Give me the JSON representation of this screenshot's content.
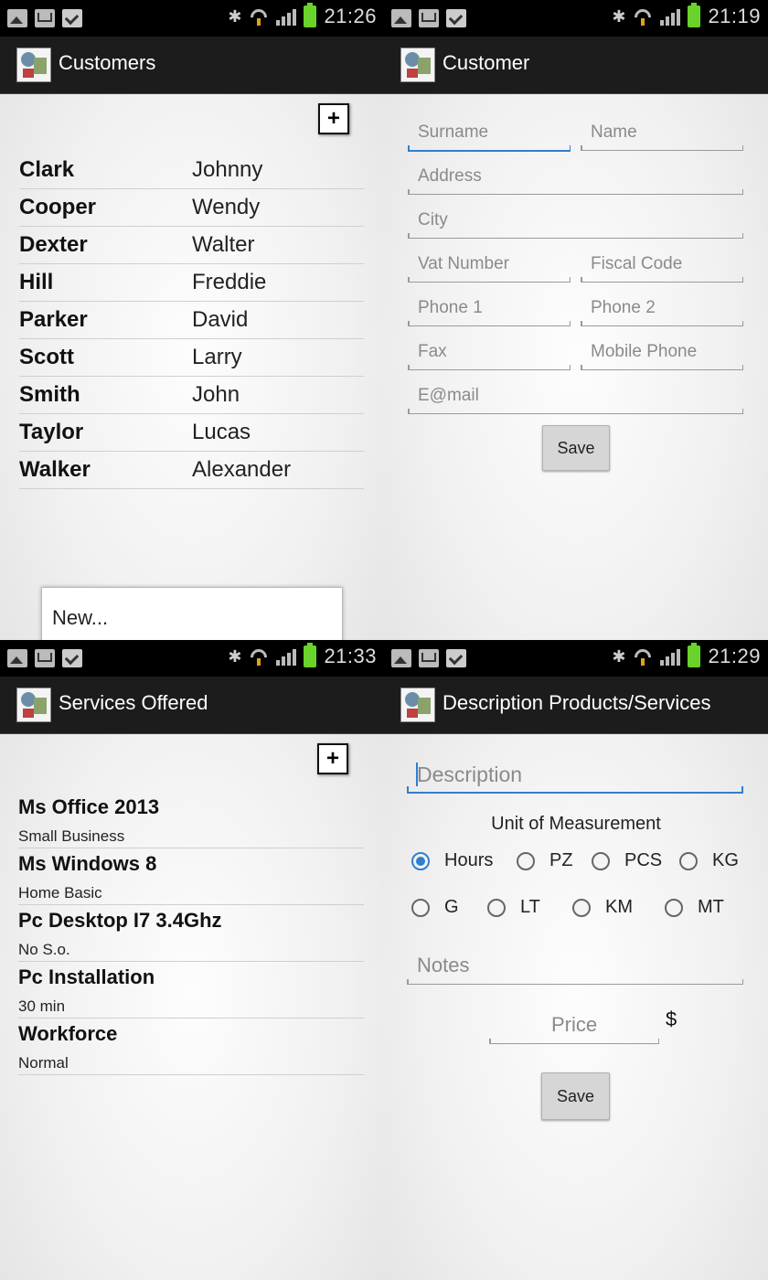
{
  "status": {
    "t1": "21:26",
    "t2": "21:19",
    "t3": "21:33",
    "t4": "21:29"
  },
  "customers": {
    "title": "Customers",
    "add_label": "+",
    "rows": [
      {
        "surname": "Clark",
        "name": "Johnny"
      },
      {
        "surname": "Cooper",
        "name": "Wendy"
      },
      {
        "surname": "Dexter",
        "name": "Walter"
      },
      {
        "surname": "Hill",
        "name": "Freddie"
      },
      {
        "surname": "Parker",
        "name": "David"
      },
      {
        "surname": "Scott",
        "name": "Larry"
      },
      {
        "surname": "Smith",
        "name": "John"
      },
      {
        "surname": "Taylor",
        "name": "Lucas"
      },
      {
        "surname": "Walker",
        "name": "Alexander"
      }
    ],
    "menu_item": "New..."
  },
  "customer": {
    "title": "Customer",
    "fields": {
      "surname": "Surname",
      "name": "Name",
      "address": "Address",
      "city": "City",
      "vat": "Vat Number",
      "fiscal": "Fiscal Code",
      "phone1": "Phone 1",
      "phone2": "Phone 2",
      "fax": "Fax",
      "mobile": "Mobile Phone",
      "email": "E@mail"
    },
    "save": "Save"
  },
  "services": {
    "title": "Services Offered",
    "add_label": "+",
    "items": [
      {
        "title": "Ms Office 2013",
        "sub": "Small Business"
      },
      {
        "title": "Ms Windows 8",
        "sub": "Home Basic"
      },
      {
        "title": "Pc Desktop I7 3.4Ghz",
        "sub": "No S.o."
      },
      {
        "title": "Pc Installation",
        "sub": "30 min"
      },
      {
        "title": "Workforce",
        "sub": "Normal"
      }
    ]
  },
  "product": {
    "title": "Description Products/Services",
    "description": "Description",
    "uom_label": "Unit of Measurement",
    "units": [
      "Hours",
      "PZ",
      "PCS",
      "KG",
      "G",
      "LT",
      "KM",
      "MT"
    ],
    "selected_unit": "Hours",
    "notes": "Notes",
    "price": "Price",
    "currency": "$",
    "save": "Save"
  },
  "colors": {
    "accent": "#2f7fd0",
    "actionbar": "#1c1c1c",
    "battery": "#6ad32a"
  }
}
